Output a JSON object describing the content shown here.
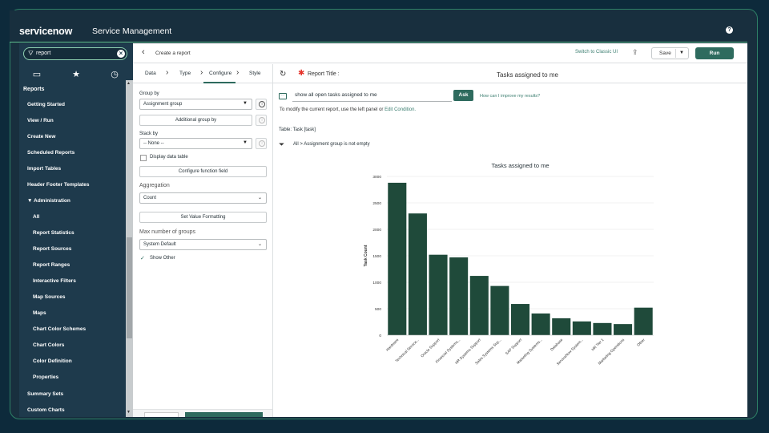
{
  "app": {
    "logo": "servicenow",
    "title": "Service Management",
    "help_icon": "help-icon"
  },
  "sidebar": {
    "search_value": "report",
    "heading": "Reports",
    "items": [
      {
        "label": "Getting Started",
        "level": 0
      },
      {
        "label": "View / Run",
        "level": 0
      },
      {
        "label": "Create New",
        "level": 0
      },
      {
        "label": "Scheduled Reports",
        "level": 0
      },
      {
        "label": "Import Tables",
        "level": 0
      },
      {
        "label": "Header Footer Templates",
        "level": 0
      },
      {
        "label": "Administration",
        "level": 0,
        "expanded": true
      },
      {
        "label": "All",
        "level": 1
      },
      {
        "label": "Report Statistics",
        "level": 1
      },
      {
        "label": "Report Sources",
        "level": 1
      },
      {
        "label": "Report Ranges",
        "level": 1
      },
      {
        "label": "Interactive Filters",
        "level": 1
      },
      {
        "label": "Map Sources",
        "level": 1
      },
      {
        "label": "Maps",
        "level": 1
      },
      {
        "label": "Chart Color Schemes",
        "level": 1
      },
      {
        "label": "Chart Colors",
        "level": 1
      },
      {
        "label": "Color Definition",
        "level": 1
      },
      {
        "label": "Properties",
        "level": 1
      },
      {
        "label": "Summary Sets",
        "level": 0
      },
      {
        "label": "Custom Charts",
        "level": 0
      }
    ]
  },
  "header": {
    "breadcrumb": "Create a report",
    "switch_link": "Switch to Classic UI",
    "save_label": "Save",
    "run_label": "Run"
  },
  "tabs": [
    "Data",
    "Type",
    "Configure",
    "Style"
  ],
  "active_tab": "Configure",
  "config": {
    "group_by_label": "Group by",
    "group_by_value": "Assignment group",
    "additional_group_by": "Additional group by",
    "stack_by_label": "Stack by",
    "stack_by_value": "-- None --",
    "display_data_table": "Display data table",
    "configure_function_field": "Configure function field",
    "aggregation_label": "Aggregation",
    "aggregation_value": "Count",
    "set_value_formatting": "Set Value Formatting",
    "max_groups_label": "Max number of groups",
    "max_groups_value": "System Default",
    "show_other": "Show Other"
  },
  "report": {
    "title_label": "Report Title :",
    "title_value": "Tasks assigned to me",
    "query": "show all open tasks assigned to me",
    "ask_label": "Ask",
    "improve_link": "How can I improve my results?",
    "modify_text": "To modify the current report, use the left panel or",
    "modify_link": "Edit Condition.",
    "table_label": "Table: Task [task]",
    "filter_all": "All",
    "filter_sep": ">",
    "filter_condition": "Assignment group is not empty"
  },
  "colors": {
    "accent": "#2e6b5e",
    "bar": "#1f4a3a",
    "sidebar": "#1e3a4c"
  },
  "chart_data": {
    "type": "bar",
    "title": "Tasks assigned to me",
    "ylabel": "Task Count",
    "xlabel": "",
    "ylim": [
      0,
      3000
    ],
    "yticks": [
      0,
      500,
      1000,
      1500,
      2000,
      2500,
      3000
    ],
    "grid": true,
    "categories": [
      "Hardware",
      "Technical Service...",
      "Oracle Support",
      "Financial Systems...",
      "HR Systems Support",
      "Sales Systems Sup...",
      "SAP Support",
      "Marketing Systems...",
      "Database",
      "ServiceNow System...",
      "HR Tier 1",
      "Marketing Operations",
      "Other"
    ],
    "values": [
      2880,
      2300,
      1520,
      1470,
      1120,
      930,
      590,
      410,
      320,
      260,
      230,
      210,
      520
    ]
  }
}
